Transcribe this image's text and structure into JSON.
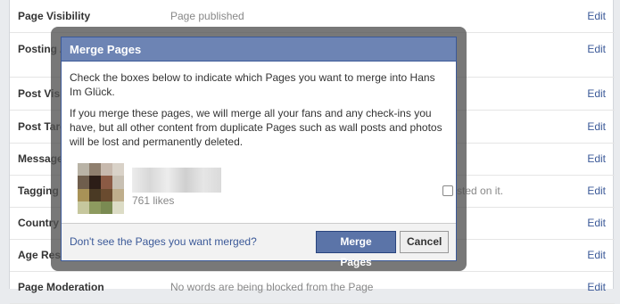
{
  "settings_rows": [
    {
      "label": "Page Visibility",
      "value": "Page published",
      "edit": "Edit"
    },
    {
      "label": "Posting A",
      "value": "",
      "edit": "Edit"
    },
    {
      "label": "Post Visi",
      "value": "",
      "edit": "Edit"
    },
    {
      "label": "Post Targ",
      "value": "",
      "edit": "Edit"
    },
    {
      "label": "Messages",
      "value": "",
      "edit": "Edit"
    },
    {
      "label": "Tagging",
      "value": "sted on it.",
      "edit": "Edit"
    },
    {
      "label": "Country",
      "value": "",
      "edit": "Edit"
    },
    {
      "label": "Age Rest",
      "value": "",
      "edit": "Edit"
    },
    {
      "label": "Page Moderation",
      "value": "No words are being blocked from the Page",
      "edit": "Edit"
    }
  ],
  "dialog": {
    "title": "Merge Pages",
    "intro": "Check the boxes below to indicate which Pages you want to merge into Hans Im Glück.",
    "warning": "If you merge these pages, we will merge all your fans and any check-ins you have, but all other content from duplicate Pages such as wall posts and photos will be lost and permanently deleted.",
    "page_item": {
      "likes": "761 likes",
      "checked": false
    },
    "footer_link": "Don't see the Pages you want merged?",
    "merge_button": "Merge Pages",
    "cancel_button": "Cancel"
  },
  "avatar_colors": [
    "#b9b3a6",
    "#8f7f6e",
    "#c7b9ad",
    "#d9d2c8",
    "#6f5e4d",
    "#2c1d17",
    "#8b5a44",
    "#c8c0b3",
    "#a89257",
    "#4a3a24",
    "#6a4b2f",
    "#bfae8c",
    "#c6c79d",
    "#8d9a5f",
    "#7a8a52",
    "#dcdcc6"
  ]
}
